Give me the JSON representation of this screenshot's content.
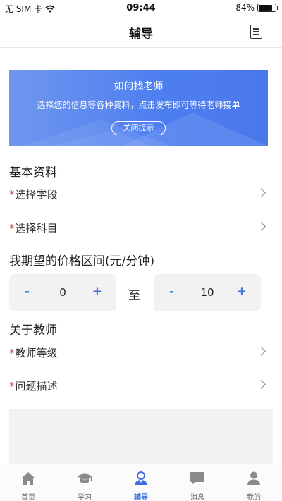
{
  "status_bar": {
    "carrier": "无 SIM 卡",
    "time": "09:44",
    "battery_text": "84%",
    "battery_level": 0.84
  },
  "nav": {
    "title": "辅导"
  },
  "banner": {
    "title": "如何找老师",
    "subtitle": "选择您的信息等各种资料，点击发布即可等待老师接单",
    "close_label": "关闭提示",
    "color": "#4d7ef0"
  },
  "basic_info": {
    "title": "基本资料",
    "rows": [
      {
        "required_mark": "*",
        "label": "选择学段"
      },
      {
        "required_mark": "*",
        "label": "选择科目"
      }
    ]
  },
  "price": {
    "title": "我期望的价格区间(元/分钟)",
    "min": {
      "minus": "-",
      "value": "0",
      "plus": "+"
    },
    "separator": "至",
    "max": {
      "minus": "-",
      "value": "10",
      "plus": "+"
    }
  },
  "teacher": {
    "title": "关于教师",
    "rows": [
      {
        "required_mark": "*",
        "label": "教师等级"
      },
      {
        "required_mark": "*",
        "label": "问题描述"
      }
    ]
  },
  "tabs": [
    {
      "label": "首页",
      "icon": "home-icon",
      "active": false
    },
    {
      "label": "学习",
      "icon": "graduation-cap-icon",
      "active": false
    },
    {
      "label": "辅导",
      "icon": "tutor-person-icon",
      "active": true
    },
    {
      "label": "消息",
      "icon": "message-icon",
      "active": false
    },
    {
      "label": "我的",
      "icon": "user-icon",
      "active": false
    }
  ],
  "colors": {
    "accent": "#3b6fe0",
    "required": "#e23b3b"
  }
}
